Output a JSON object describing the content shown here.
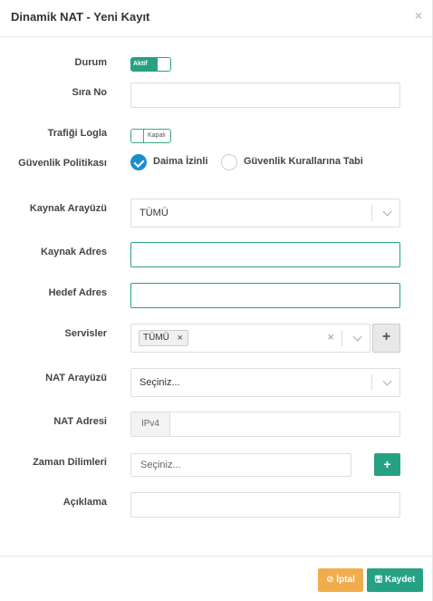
{
  "header": {
    "title": "Dinamik NAT - Yeni Kayıt",
    "close": "×"
  },
  "form": {
    "durum": {
      "label": "Durum",
      "toggle_text": "Aktif"
    },
    "sira_no": {
      "label": "Sıra No",
      "value": ""
    },
    "trafik": {
      "label": "Trafiği Logla",
      "toggle_text": "Kapalı"
    },
    "politika": {
      "label": "Güvenlik Politikası",
      "options": [
        "Daima İzinli",
        "Güvenlik Kurallarına Tabi"
      ],
      "selected": "Daima İzinli"
    },
    "kaynak_arayuz": {
      "label": "Kaynak Arayüzü",
      "value": "TÜMÜ"
    },
    "kaynak_adres": {
      "label": "Kaynak Adres",
      "value": ""
    },
    "hedef_adres": {
      "label": "Hedef Adres",
      "value": ""
    },
    "servisler": {
      "label": "Servisler",
      "chip": "TÜMÜ",
      "chip_remove": "×",
      "clear": "×",
      "add": "+"
    },
    "nat_arayuz": {
      "label": "NAT Arayüzü",
      "value": "Seçiniz..."
    },
    "nat_adresi": {
      "label": "NAT Adresi",
      "prefix": "IPv4",
      "value": ""
    },
    "zaman": {
      "label": "Zaman Dilimleri",
      "placeholder": "Seçiniz...",
      "add": "+"
    },
    "aciklama": {
      "label": "Açıklama",
      "value": ""
    }
  },
  "footer": {
    "cancel_label": "İptal",
    "save_label": "Kaydet",
    "cancel_icon": "ban-icon",
    "save_icon": "floppy-icon"
  },
  "colors": {
    "accent": "#26a184",
    "warning": "#f0ad4e",
    "radio": "#1a8ed1"
  }
}
